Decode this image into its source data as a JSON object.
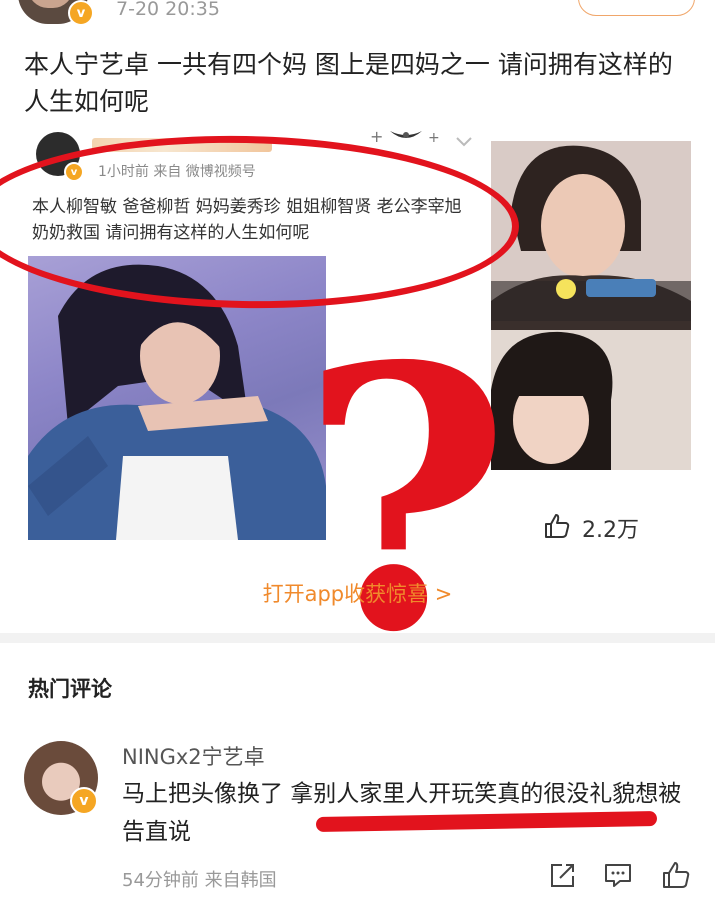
{
  "post": {
    "time": "7-20 20:35",
    "text": "本人宁艺卓 一共有四个妈 图上是四妈之一 请问拥有这样的人生如何呢",
    "likes": "2.2万",
    "open_app": "打开app收获惊喜 >"
  },
  "embedded": {
    "meta": "1小时前  来自 微博视频号",
    "text": "本人柳智敏 爸爸柳哲 妈妈姜秀珍 姐姐柳智贤 老公李宰旭 奶奶救国 请问拥有这样的人生如何呢"
  },
  "badge_char": "v",
  "overlay_qmark": "?",
  "comments": {
    "section_title": "热门评论",
    "items": [
      {
        "user": "NINGx2宁艺卓",
        "text": "马上把头像换了 拿别人家里人开玩笑真的很没礼貌想被告直说",
        "meta": "54分钟前  来自韩国"
      }
    ]
  },
  "colors": {
    "accent_orange": "#f08a2c",
    "annotation_red": "#e2131d",
    "verified": "#f5a623"
  },
  "icons": [
    "thumb-up-icon",
    "share-icon",
    "comment-icon",
    "like-icon",
    "chevron-down-icon",
    "verified-badge-icon"
  ]
}
